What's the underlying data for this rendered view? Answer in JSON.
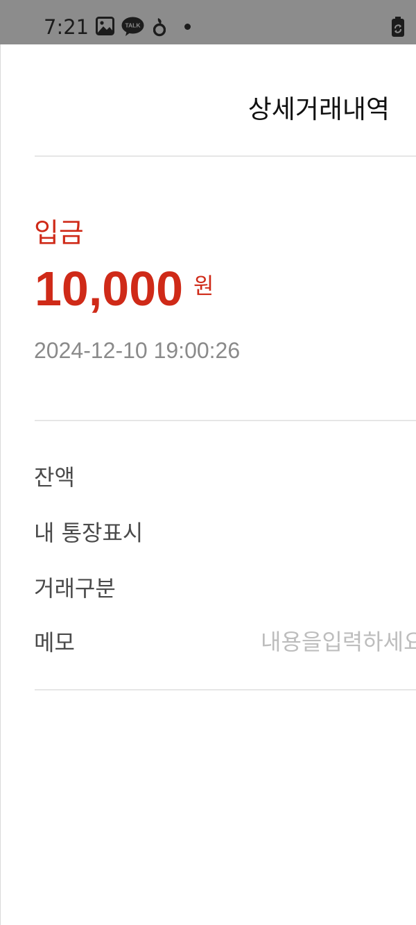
{
  "status_bar": {
    "time": "7:21",
    "icons": [
      "gallery-icon",
      "kakaotalk-icon",
      "notification-app-icon",
      "notification-dot",
      "battery-saver-icon"
    ],
    "talk_label": "TALK"
  },
  "header": {
    "title": "상세거래내역"
  },
  "transaction": {
    "type_label": "입금",
    "amount": "10,000",
    "currency_unit": "원",
    "datetime": "2024-12-10 19:00:26",
    "accent_color": "#cf2a18"
  },
  "details": {
    "balance_label": "잔액",
    "passbook_label": "내 통장표시",
    "category_label": "거래구분",
    "memo_label": "메모",
    "memo_placeholder": "내용을입력하세요",
    "memo_value": ""
  }
}
